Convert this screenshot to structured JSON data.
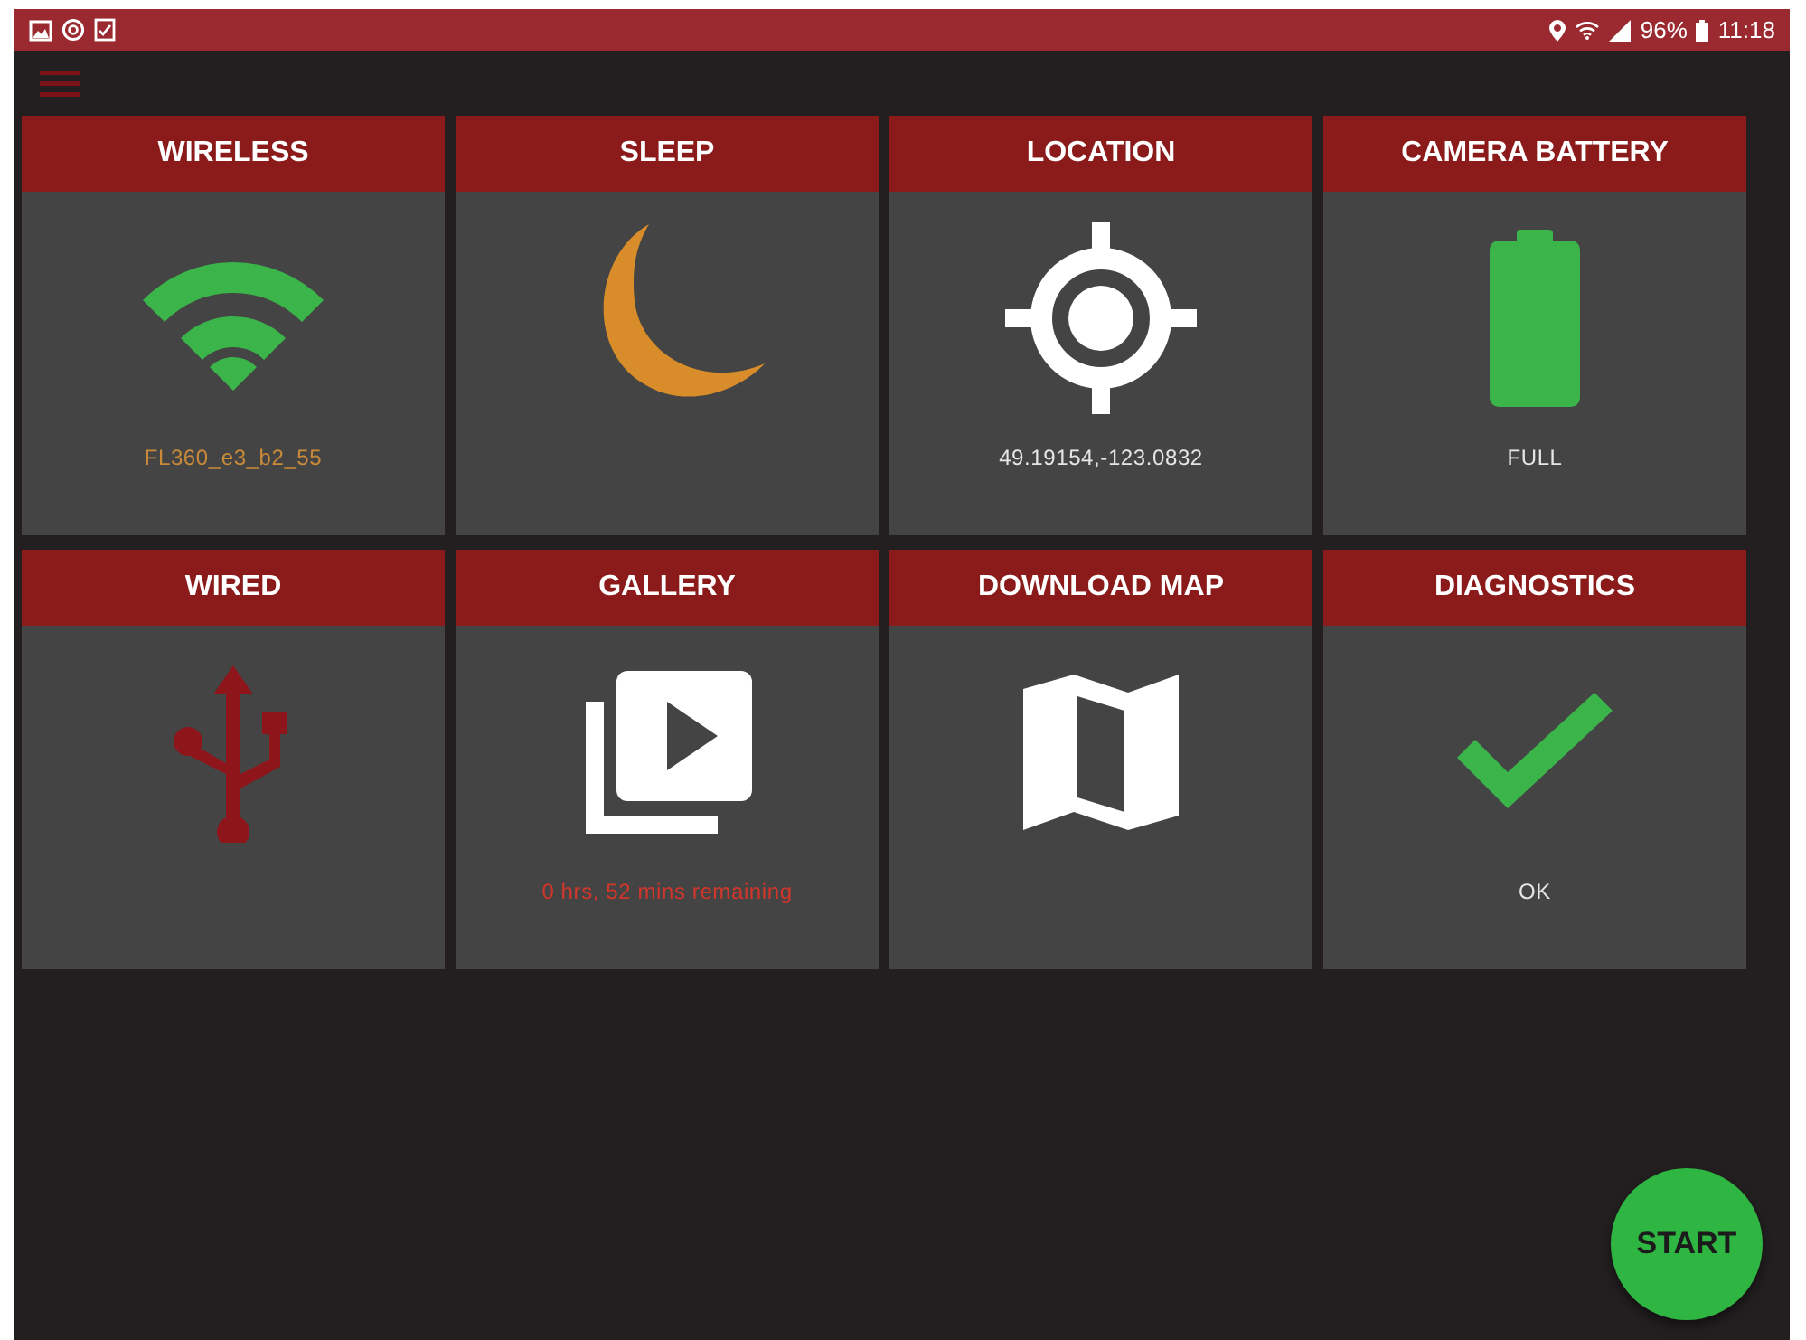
{
  "status_bar": {
    "battery_percent": "96%",
    "time": "11:18"
  },
  "tiles": [
    {
      "title": "WIRELESS",
      "kind": "wifi",
      "caption": "FL360_e3_b2_55",
      "color": "#c98a3a"
    },
    {
      "title": "SLEEP",
      "kind": "moon"
    },
    {
      "title": "LOCATION",
      "kind": "crosshair",
      "caption": "49.19154,-123.0832",
      "color": "#e6e6e6"
    },
    {
      "title": "CAMERA BATTERY",
      "kind": "battery",
      "caption": "FULL",
      "color": "#e6e6e6"
    },
    {
      "title": "WIRED",
      "kind": "usb"
    },
    {
      "title": "GALLERY",
      "kind": "gallery",
      "caption": "0 hrs, 52 mins remaining",
      "color": "#d2362b"
    },
    {
      "title": "DOWNLOAD MAP",
      "kind": "map"
    },
    {
      "title": "DIAGNOSTICS",
      "kind": "check",
      "caption": "OK",
      "color": "#e6e6e6"
    }
  ],
  "start_button": {
    "label": "START"
  }
}
